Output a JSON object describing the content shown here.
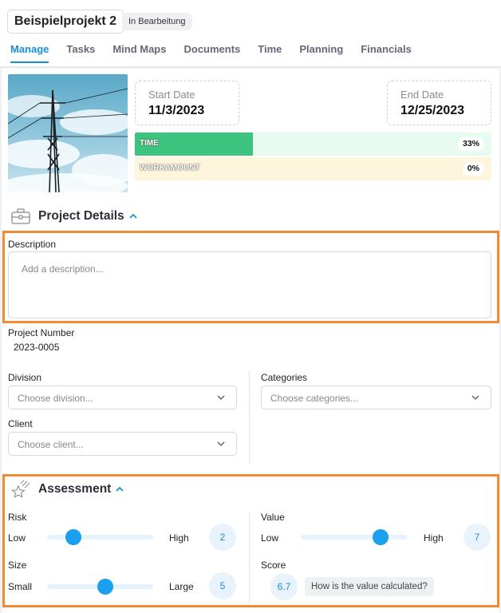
{
  "header": {
    "project_title": "Beispielprojekt 2",
    "status": "In Bearbeitung",
    "tabs": [
      {
        "label": "Manage",
        "active": true
      },
      {
        "label": "Tasks"
      },
      {
        "label": "Mind Maps"
      },
      {
        "label": "Documents"
      },
      {
        "label": "Time"
      },
      {
        "label": "Planning"
      },
      {
        "label": "Financials"
      }
    ]
  },
  "overview": {
    "start_label": "Start Date",
    "start_value": "11/3/2023",
    "end_label": "End Date",
    "end_value": "12/25/2023",
    "time_label": "TIME",
    "time_pct": "33%",
    "time_fraction": 0.33,
    "work_label": "WORKAMOUNT",
    "work_pct": "0%",
    "work_fraction": 0
  },
  "details": {
    "title": "Project Details",
    "description_label": "Description",
    "description_placeholder": "Add a description...",
    "project_number_label": "Project Number",
    "project_number": "2023-0005",
    "division_label": "Division",
    "division_placeholder": "Choose division...",
    "client_label": "Client",
    "client_placeholder": "Choose client...",
    "categories_label": "Categories",
    "categories_placeholder": "Choose categories..."
  },
  "assessment": {
    "title": "Assessment",
    "risk": {
      "label": "Risk",
      "low": "Low",
      "high": "High",
      "value": "2",
      "level": 0.25
    },
    "value": {
      "label": "Value",
      "low": "Low",
      "high": "High",
      "value": "7",
      "level": 0.75
    },
    "size": {
      "label": "Size",
      "low": "Small",
      "high": "Large",
      "value": "5",
      "level": 0.55
    },
    "score": {
      "label": "Score",
      "value": "6.7",
      "help": "How is the value calculated?"
    }
  },
  "colors": {
    "accent": "#1a8fd8",
    "highlight": "#f08a34",
    "time_bar": "#3dc47e"
  }
}
